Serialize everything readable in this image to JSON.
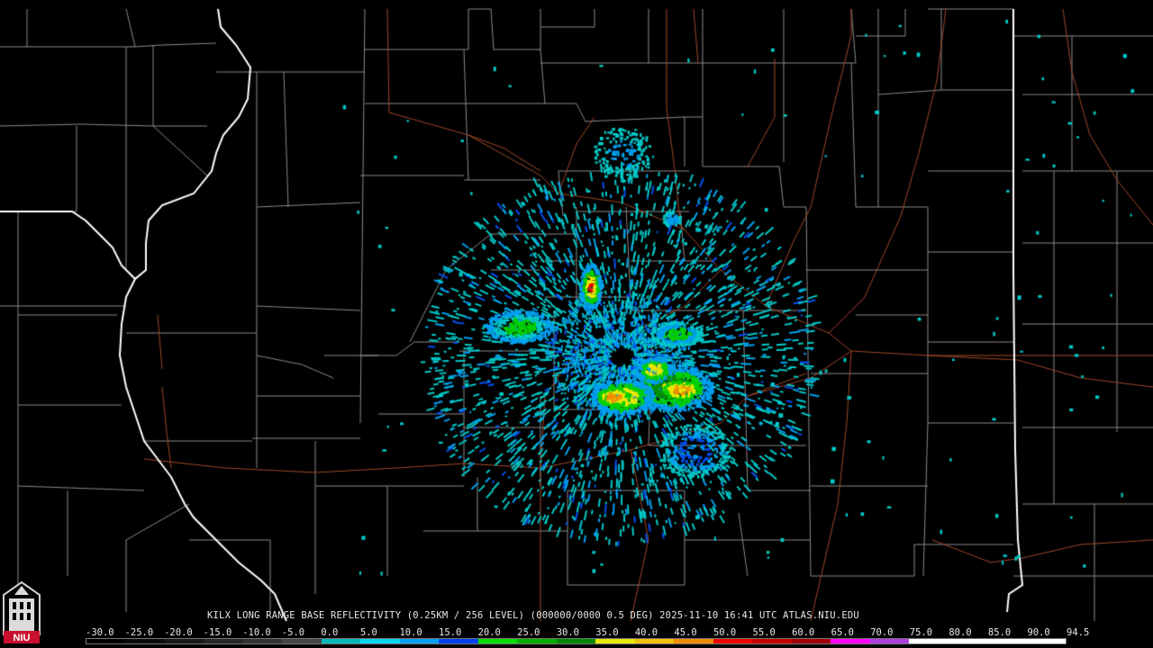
{
  "product": {
    "caption": "KILX LONG RANGE BASE REFLECTIVITY (0.25KM / 256 LEVEL) (000000/0000 0.5 DEG) 2025-11-10 16:41 UTC  ATLAS.NIU.EDU"
  },
  "logo": {
    "text": "NIU",
    "icon": "university-tower-icon"
  },
  "colorscale": {
    "tick_labels": [
      "-30.0",
      "-25.0",
      "-20.0",
      "-15.0",
      "-10.0",
      "-5.0",
      "0.0",
      "5.0",
      "10.0",
      "15.0",
      "20.0",
      "25.0",
      "30.0",
      "35.0",
      "40.0",
      "45.0",
      "50.0",
      "55.0",
      "60.0",
      "65.0",
      "70.0",
      "75.0",
      "80.0",
      "85.0",
      "90.0",
      "94.5"
    ],
    "colors": [
      "#000000",
      "#0b0b0b",
      "#181818",
      "#262626",
      "#333333",
      "#454545",
      "#00b8b8",
      "#00d8f0",
      "#00a0f0",
      "#0040f0",
      "#00e000",
      "#00b000",
      "#008800",
      "#e8e800",
      "#f0c000",
      "#f08c00",
      "#f00000",
      "#c80000",
      "#a00000",
      "#ff00ff",
      "#b040e0",
      "#ffffff",
      "#ffffff",
      "#ffffff",
      "#ffffff"
    ]
  },
  "map": {
    "state_border_color": "#ffffff",
    "county_line_color": "#8a8a8a",
    "highway_color": "#a04828",
    "echo_colors": {
      "weak_cyan": "#00c8c8",
      "light_blue": "#00a0f0",
      "blue": "#0050f0",
      "green": "#00d000",
      "dark_green": "#009000",
      "yellow": "#e8e800",
      "orange": "#f09000",
      "red": "#f00000"
    }
  }
}
